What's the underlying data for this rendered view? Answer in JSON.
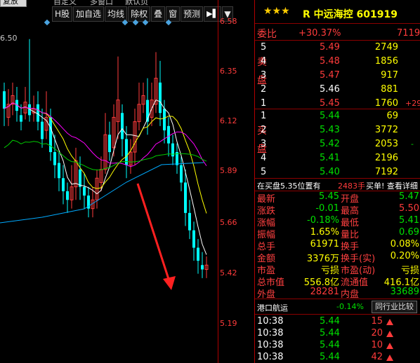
{
  "toolbar": {
    "top_partial_1": "复放",
    "top_partial_2": "自定义",
    "top_partial_3": "多窗口",
    "top_partial_4": "默认页",
    "buttons": [
      "H股",
      "加自选",
      "均线",
      "除权",
      "叠",
      "窗",
      "预测"
    ],
    "play_icon": "▶▌",
    "dropdown_icon": "▼"
  },
  "chart": {
    "ma_label": "6.50",
    "price_axis": [
      "6.58",
      "6.35",
      "6.12",
      "5.89",
      "5.66",
      "5.42",
      "5.19"
    ],
    "colors": {
      "up": "#ff3b3b",
      "down": "#00ffff",
      "ma5": "#ffffff",
      "ma10": "#ffff00",
      "ma20": "#ff00ff",
      "ma30": "#00cc00",
      "ma60": "#00aaff",
      "arrow": "#ff2020"
    }
  },
  "quote": {
    "stars": "★★★",
    "title": "R 中远海控 601919",
    "weibi": {
      "label": "委比",
      "value": "+30.37%",
      "extra": "7119"
    },
    "sell_side_label": "卖盘",
    "buy_side_label": "买盘",
    "sell": [
      {
        "level": "5",
        "price": "5.49",
        "vol": "2749",
        "extra": ""
      },
      {
        "level": "4",
        "price": "5.48",
        "vol": "1856",
        "extra": ""
      },
      {
        "level": "3",
        "price": "5.47",
        "vol": "917",
        "extra": ""
      },
      {
        "level": "2",
        "price": "5.46",
        "vol": "881",
        "extra": ""
      },
      {
        "level": "1",
        "price": "5.45",
        "vol": "1760",
        "extra": "+29"
      }
    ],
    "buy": [
      {
        "level": "1",
        "price": "5.44",
        "vol": "69",
        "extra": ""
      },
      {
        "level": "2",
        "price": "5.43",
        "vol": "3772",
        "extra": ""
      },
      {
        "level": "3",
        "price": "5.42",
        "vol": "2053",
        "extra": "-"
      },
      {
        "level": "4",
        "price": "5.41",
        "vol": "2196",
        "extra": ""
      },
      {
        "level": "5",
        "price": "5.40",
        "vol": "7192",
        "extra": ""
      }
    ],
    "notice": {
      "text": "在买盘5.35位置有",
      "vol": "2483手",
      "tail": "买单! 查看详细"
    },
    "stats": [
      {
        "l1": "最新",
        "v1": "5.45",
        "c1": "green",
        "l2": "开盘",
        "v2": "5.47",
        "c2": "green"
      },
      {
        "l1": "涨跌",
        "v1": "-0.01",
        "c1": "green",
        "l2": "最高",
        "v2": "5.50",
        "c2": "red"
      },
      {
        "l1": "涨幅",
        "v1": "-0.18%",
        "c1": "green",
        "l2": "最低",
        "v2": "5.41",
        "c2": "green"
      },
      {
        "l1": "振幅",
        "v1": "1.65%",
        "c1": "yellow",
        "l2": "量比",
        "v2": "0.69",
        "c2": "green"
      },
      {
        "l1": "总手",
        "v1": "61971",
        "c1": "yellow",
        "l2": "换手",
        "v2": "0.08%",
        "c2": "yellow"
      },
      {
        "l1": "金额",
        "v1": "3376万",
        "c1": "yellow",
        "l2": "换手(实)",
        "v2": "0.20%",
        "c2": "yellow"
      },
      {
        "l1": "市盈",
        "v1": "亏损",
        "c1": "yellow",
        "l2": "市盈(动)",
        "v2": "亏损",
        "c2": "yellow"
      },
      {
        "l1": "总市值",
        "v1": "556.8亿",
        "c1": "yellow",
        "l2": "流通值",
        "v2": "416.1亿",
        "c2": "yellow"
      },
      {
        "l1": "外盘",
        "v1": "28281",
        "c1": "red",
        "l2": "内盘",
        "v2": "33689",
        "c2": "green"
      }
    ],
    "sector": {
      "name": "港口航运",
      "change": "-0.14%",
      "button": "同行业比较"
    },
    "ticks": [
      {
        "time": "10:38",
        "price": "5.44",
        "vol": "15"
      },
      {
        "time": "10:38",
        "price": "5.44",
        "vol": "20"
      },
      {
        "time": "10:38",
        "price": "5.44",
        "vol": "10"
      },
      {
        "time": "10:38",
        "price": "5.44",
        "vol": "42"
      }
    ]
  }
}
